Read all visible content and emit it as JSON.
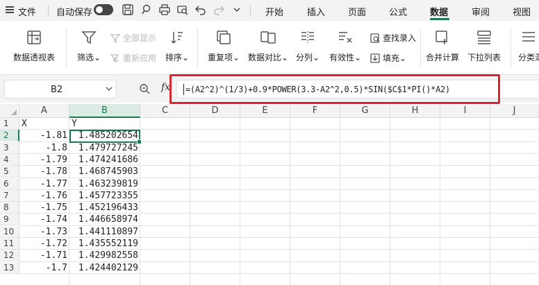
{
  "menubar": {
    "file_label": "文件",
    "autosave_label": "自动保存",
    "tabs": [
      {
        "label": "开始",
        "active": false
      },
      {
        "label": "插入",
        "active": false
      },
      {
        "label": "页面",
        "active": false
      },
      {
        "label": "公式",
        "active": false
      },
      {
        "label": "数据",
        "active": true
      },
      {
        "label": "审阅",
        "active": false
      },
      {
        "label": "视图",
        "active": false
      }
    ]
  },
  "ribbon": {
    "pivot_table": "数据透视表",
    "filter": "筛选",
    "show_all": "全部显示",
    "reapply": "重新应用",
    "sort": "排序",
    "duplicates": "重复项",
    "compare": "数据对比",
    "split": "分列",
    "validity": "有效性",
    "lookup_entry": "查找录入",
    "fill": "填充",
    "consolidate": "合并计算",
    "dropdown_list": "下拉列表",
    "group_summary": "分类汇"
  },
  "formula_bar": {
    "name_box": "B2",
    "fx_label": "fx",
    "formula": "=(A2^2)^(1/3)+0.9*POWER(3.3-A2^2,0.5)*SIN($C$1*PI()*A2)"
  },
  "grid": {
    "columns": [
      "A",
      "B",
      "C",
      "D",
      "E",
      "F",
      "G",
      "H",
      "I",
      "J"
    ],
    "rows": [
      "1",
      "2",
      "3",
      "4",
      "5",
      "6",
      "7",
      "8",
      "9",
      "10",
      "11",
      "12",
      "13"
    ],
    "cells_a": [
      "X",
      "-1.81",
      "-1.8",
      "-1.79",
      "-1.78",
      "-1.77",
      "-1.76",
      "-1.75",
      "-1.74",
      "-1.73",
      "-1.72",
      "-1.71",
      "-1.7"
    ],
    "cells_b": [
      "Y",
      "1.485202654",
      "1.479727245",
      "1.474241686",
      "1.468745903",
      "1.463239819",
      "1.457723355",
      "1.452196433",
      "1.446658974",
      "1.441110897",
      "1.435552119",
      "1.429982558",
      "1.424402129"
    ]
  },
  "colors": {
    "accent": "#1a7a50",
    "highlight_box": "#d6262f"
  }
}
